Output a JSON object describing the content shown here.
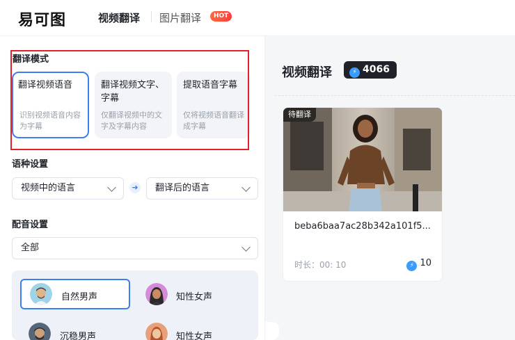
{
  "header": {
    "logo": "易可图",
    "nav_active": "视频翻译",
    "nav_item": "图片翻译",
    "hot_badge": "HOT"
  },
  "left": {
    "mode_title": "翻译模式",
    "modes": [
      {
        "name": "翻译视频语音",
        "desc": "识别视频语音内容为字幕",
        "selected": true
      },
      {
        "name": "翻译视频文字、字幕",
        "desc": "仅翻译视频中的文字及字幕内容",
        "selected": false
      },
      {
        "name": "提取语音字幕",
        "desc": "仅将视频语音翻译成字幕",
        "selected": false
      }
    ],
    "lang_title": "语种设置",
    "source_lang_placeholder": "视频中的语言",
    "target_lang_placeholder": "翻译后的语言",
    "dub_title": "配音设置",
    "dub_select": "全部",
    "voices": [
      {
        "label": "自然男声",
        "selected": true
      },
      {
        "label": "知性女声",
        "selected": false
      },
      {
        "label": "沉稳男声",
        "selected": false
      },
      {
        "label": "知性女声",
        "selected": false
      }
    ]
  },
  "right": {
    "title": "视频翻译",
    "credits": "4066",
    "video": {
      "status_tag": "待翻译",
      "filename": "beba6baa7ac28b342a101f5...",
      "duration": "时长：00: 10",
      "cost": "10"
    }
  },
  "colors": {
    "accent": "#3a7ef0",
    "highlight_border": "#e0212b",
    "hot": "#ff4a3d",
    "credit_bg": "#1f2329"
  }
}
